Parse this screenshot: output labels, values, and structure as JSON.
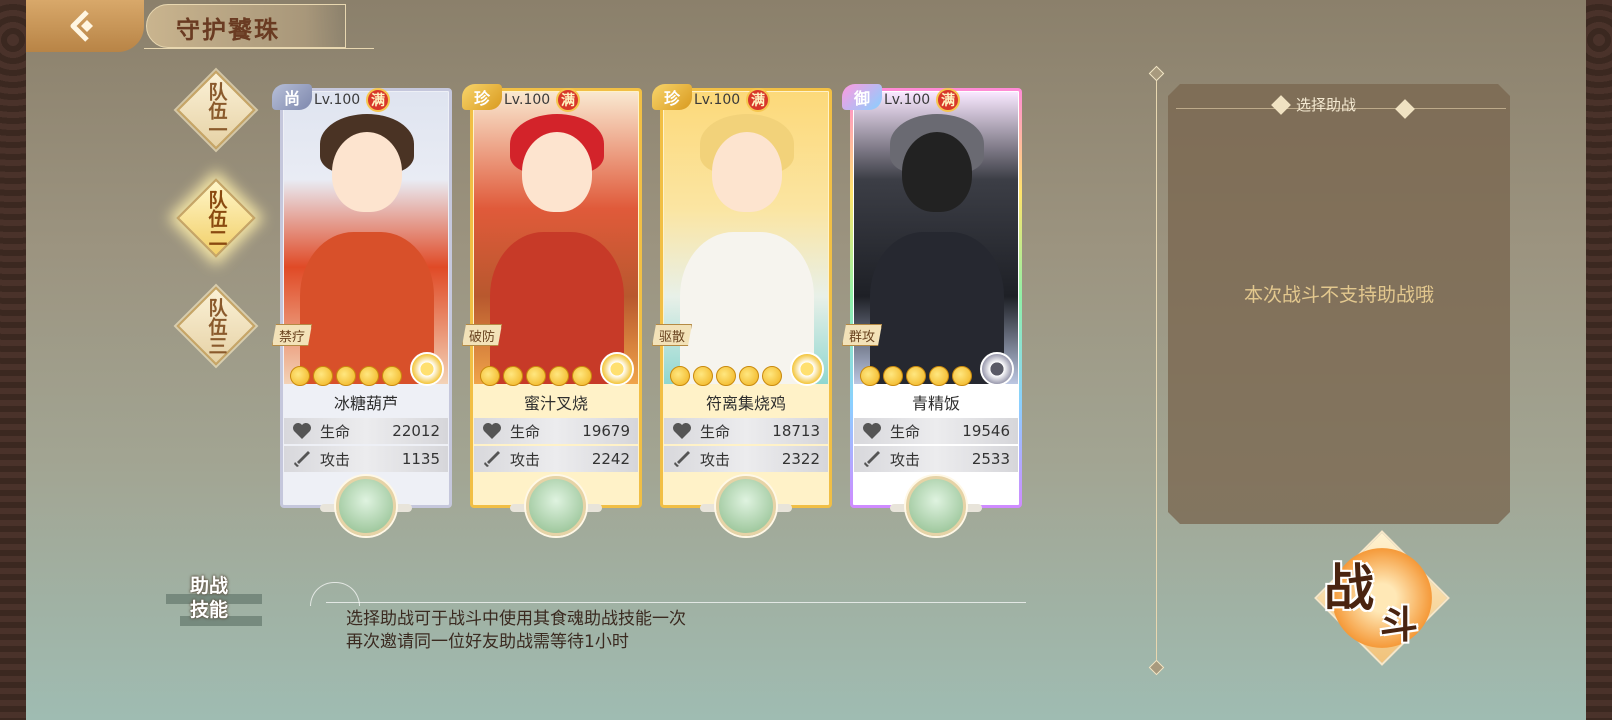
{
  "header": {
    "title": "守护饕珠"
  },
  "teams": [
    {
      "label": "队伍一",
      "active": false
    },
    {
      "label": "队伍二",
      "active": true
    },
    {
      "label": "队伍三",
      "active": false
    }
  ],
  "cards": [
    {
      "rarity": "尚",
      "level": "Lv.100",
      "max": "满",
      "role": "禁疗",
      "name": "冰糖葫芦",
      "hp_label": "生命",
      "hp": "22012",
      "atk_label": "攻击",
      "atk": "1135",
      "stars": 6
    },
    {
      "rarity": "珍",
      "level": "Lv.100",
      "max": "满",
      "role": "破防",
      "name": "蜜汁叉烧",
      "hp_label": "生命",
      "hp": "19679",
      "atk_label": "攻击",
      "atk": "2242",
      "stars": 6
    },
    {
      "rarity": "珍",
      "level": "Lv.100",
      "max": "满",
      "role": "驱散",
      "name": "符离集烧鸡",
      "hp_label": "生命",
      "hp": "18713",
      "atk_label": "攻击",
      "atk": "2322",
      "stars": 6
    },
    {
      "rarity": "御",
      "level": "Lv.100",
      "max": "满",
      "role": "群攻",
      "name": "青精饭",
      "hp_label": "生命",
      "hp": "19546",
      "atk_label": "攻击",
      "atk": "2533",
      "stars": 6
    }
  ],
  "assist": {
    "title": "选择助战",
    "message": "本次战斗不支持助战哦"
  },
  "battle": {
    "char1": "战",
    "char2": "斗"
  },
  "skill": {
    "label_line1": "助战",
    "label_line2": "技能",
    "desc_line1": "选择助战可于战斗中使用其食魂助战技能一次",
    "desc_line2": "再次邀请同一位好友助战需等待1小时"
  }
}
